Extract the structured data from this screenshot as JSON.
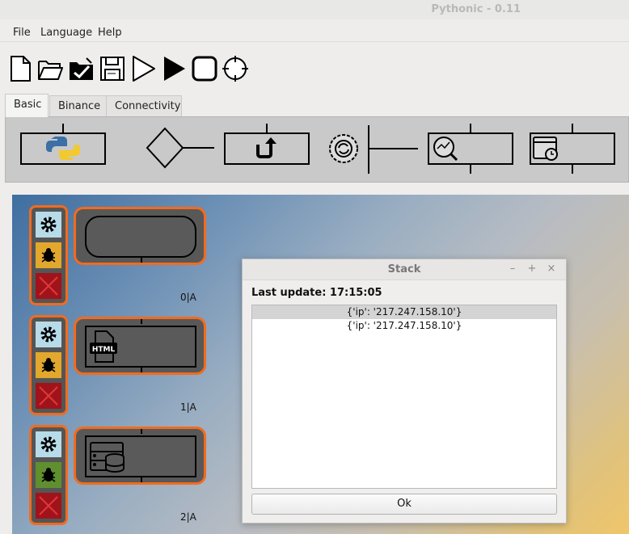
{
  "window": {
    "title": "Pythonic - 0.11"
  },
  "menu": {
    "file": "File",
    "language": "Language",
    "help": "Help"
  },
  "toolbar": {
    "icons": [
      "new-file-icon",
      "open-folder-icon",
      "save-as-icon",
      "save-icon",
      "start-debug-icon",
      "start-icon",
      "stop-icon",
      "kill-icon"
    ]
  },
  "tabs": [
    {
      "label": "Basic",
      "active": true
    },
    {
      "label": "Binance",
      "active": false
    },
    {
      "label": "Connectivity",
      "active": false
    }
  ],
  "palette": {
    "icons": [
      "python-icon",
      "branch-icon",
      "return-icon",
      "scheduler-process-icon",
      "scan-icon",
      "calendar-icon"
    ]
  },
  "elements": [
    {
      "label": "0|A",
      "icon": "start-element-icon",
      "debug": "yellow"
    },
    {
      "label": "1|A",
      "icon": "html-icon",
      "debug": "yellow"
    },
    {
      "label": "2|A",
      "icon": "database-icon",
      "debug": "green"
    }
  ],
  "colors": {
    "accent": "#f26b1d",
    "settings_bg": "#b7dbe8",
    "debug_bg": "#e2a82d",
    "debug_active_bg": "#5f8f2e",
    "delete_bg": "#a0131a"
  },
  "dialog": {
    "title": "Stack",
    "minimize": "–",
    "maximize": "+",
    "close": "×",
    "last_update_label": "Last update: 17:15:05",
    "rows": [
      "{'ip': '217.247.158.10'}",
      "{'ip': '217.247.158.10'}"
    ],
    "ok_label": "Ok"
  }
}
